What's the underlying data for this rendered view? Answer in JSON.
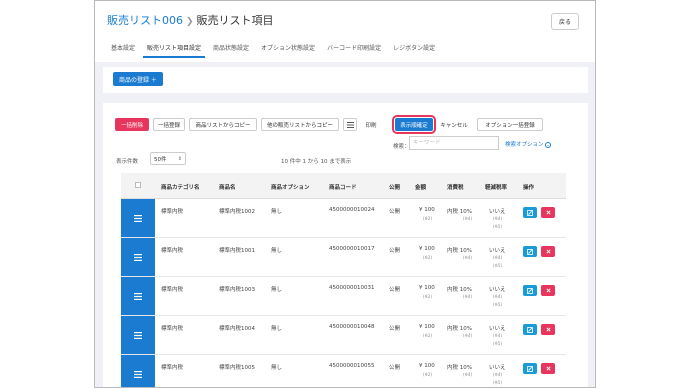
{
  "breadcrumb": {
    "parent": "販売リスト006",
    "current": "販売リスト項目"
  },
  "back_label": "戻る",
  "tabs": [
    "基本設定",
    "販売リスト項目設定",
    "商品状態設定",
    "オプション状態設定",
    "バーコード印刷設定",
    "レジボタン設定"
  ],
  "register_label": "商品の登録 ＋",
  "toolbar": {
    "bulk_delete": "一括削除",
    "bulk_register": "一括登録",
    "copy_from_product": "商品リストからコピー",
    "copy_from_other": "他の販売リストからコピー",
    "print": "印刷",
    "confirm_order": "表示順確定",
    "cancel": "キャンセル",
    "option_bulk": "オプション一括登録"
  },
  "search": {
    "label": "検索：",
    "placeholder": "キーワード",
    "option_link": "検索オプション"
  },
  "count_label": "表示件数",
  "per_page": "50件",
  "summary": "10 件中 1 から 10 まで表示",
  "columns": [
    "商品カテゴリ名",
    "商品名",
    "商品オプション",
    "商品コード",
    "公開",
    "金額",
    "消費税",
    "軽減税率",
    "操作"
  ],
  "rows": [
    {
      "category": "標準内税",
      "name": "標準内税1002",
      "option": "無し",
      "code": "4500000010024",
      "public": "公開",
      "price": "¥ 100",
      "price_sub": "(※2)",
      "tax": "内税 10%",
      "tax_sub": "(※4)",
      "reduced": "いいえ",
      "reduced_sub1": "(※4)",
      "reduced_sub2": "(※5)"
    },
    {
      "category": "標準内税",
      "name": "標準内税1001",
      "option": "無し",
      "code": "4500000010017",
      "public": "公開",
      "price": "¥ 100",
      "price_sub": "(※2)",
      "tax": "内税 10%",
      "tax_sub": "(※4)",
      "reduced": "いいえ",
      "reduced_sub1": "(※4)",
      "reduced_sub2": "(※5)"
    },
    {
      "category": "標準内税",
      "name": "標準内税1003",
      "option": "無し",
      "code": "4500000010031",
      "public": "公開",
      "price": "¥ 100",
      "price_sub": "(※2)",
      "tax": "内税 10%",
      "tax_sub": "(※4)",
      "reduced": "いいえ",
      "reduced_sub1": "(※4)",
      "reduced_sub2": "(※5)"
    },
    {
      "category": "標準内税",
      "name": "標準内税1004",
      "option": "無し",
      "code": "4500000010048",
      "public": "公開",
      "price": "¥ 100",
      "price_sub": "(※2)",
      "tax": "内税 10%",
      "tax_sub": "(※4)",
      "reduced": "いいえ",
      "reduced_sub1": "(※4)",
      "reduced_sub2": "(※5)"
    },
    {
      "category": "標準内税",
      "name": "標準内税1005",
      "option": "無し",
      "code": "4500000010055",
      "public": "公開",
      "price": "¥ 100",
      "price_sub": "(※2)",
      "tax": "内税 10%",
      "tax_sub": "(※4)",
      "reduced": "いいえ",
      "reduced_sub1": "(※4)",
      "reduced_sub2": "(※5)"
    }
  ],
  "colors": {
    "accent": "#1a7bd0",
    "danger": "#e8355e",
    "edit": "#1a9ad6"
  }
}
